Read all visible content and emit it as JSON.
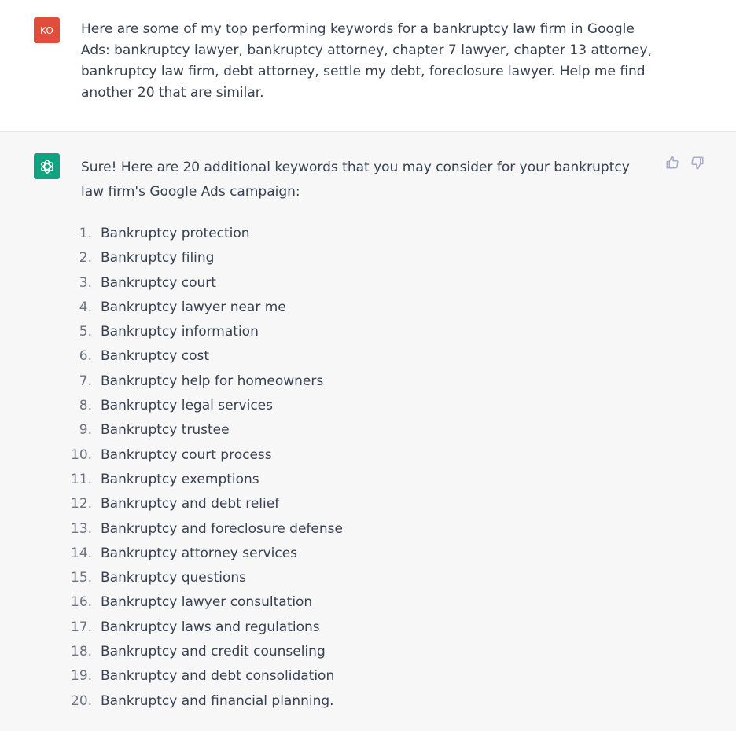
{
  "conversation": {
    "user_message": {
      "avatar_initials": "KO",
      "avatar_color": "#e24d3b",
      "text": "Here are some of my top performing keywords for a bankruptcy law firm in Google Ads: bankruptcy lawyer, bankruptcy attorney, chapter 7 lawyer, chapter 13 attorney, bankruptcy law firm, debt attorney, settle my debt, foreclosure lawyer. Help me find another 20 that are similar."
    },
    "assistant_message": {
      "avatar_icon": "openai-logo-icon",
      "avatar_color": "#10a37f",
      "intro": "Sure! Here are 20 additional keywords that you may consider for your bankruptcy law firm's Google Ads campaign:",
      "keywords": [
        {
          "num": "1.",
          "text": "Bankruptcy protection"
        },
        {
          "num": "2.",
          "text": "Bankruptcy filing"
        },
        {
          "num": "3.",
          "text": "Bankruptcy court"
        },
        {
          "num": "4.",
          "text": "Bankruptcy lawyer near me"
        },
        {
          "num": "5.",
          "text": "Bankruptcy information"
        },
        {
          "num": "6.",
          "text": "Bankruptcy cost"
        },
        {
          "num": "7.",
          "text": "Bankruptcy help for homeowners"
        },
        {
          "num": "8.",
          "text": "Bankruptcy legal services"
        },
        {
          "num": "9.",
          "text": "Bankruptcy trustee"
        },
        {
          "num": "10.",
          "text": "Bankruptcy court process"
        },
        {
          "num": "11.",
          "text": "Bankruptcy exemptions"
        },
        {
          "num": "12.",
          "text": "Bankruptcy and debt relief"
        },
        {
          "num": "13.",
          "text": "Bankruptcy and foreclosure defense"
        },
        {
          "num": "14.",
          "text": "Bankruptcy attorney services"
        },
        {
          "num": "15.",
          "text": "Bankruptcy questions"
        },
        {
          "num": "16.",
          "text": "Bankruptcy lawyer consultation"
        },
        {
          "num": "17.",
          "text": "Bankruptcy laws and regulations"
        },
        {
          "num": "18.",
          "text": "Bankruptcy and credit counseling"
        },
        {
          "num": "19.",
          "text": "Bankruptcy and debt consolidation"
        },
        {
          "num": "20.",
          "text": "Bankruptcy and financial planning."
        }
      ],
      "feedback": {
        "thumbs_up": "thumbs-up-icon",
        "thumbs_down": "thumbs-down-icon"
      }
    }
  }
}
